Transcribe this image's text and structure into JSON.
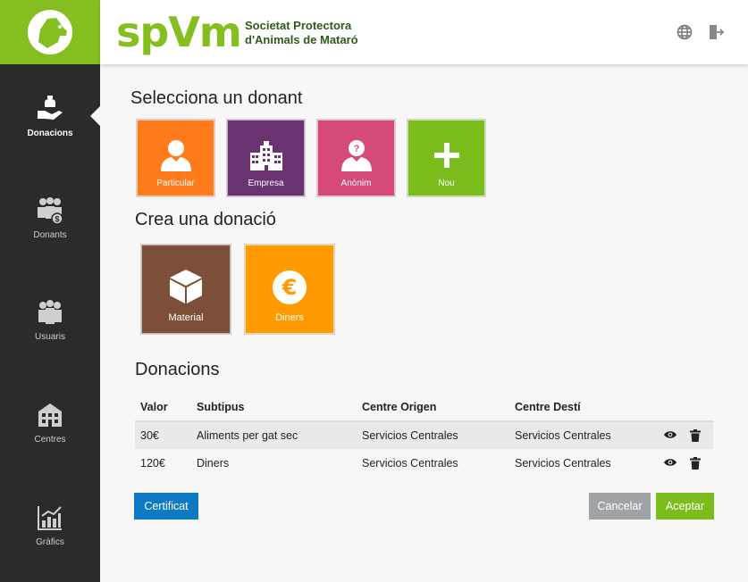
{
  "header": {
    "brand": "spVm",
    "brand_sub_line1": "Societat Protectora",
    "brand_sub_line2": "d'Animals de Mataró",
    "icons": [
      "globe-icon",
      "logout-icon"
    ]
  },
  "sidebar": {
    "items": [
      {
        "label": "Donacions",
        "icon": "donation-hand-icon",
        "active": true
      },
      {
        "label": "Donants",
        "icon": "donors-group-icon",
        "active": false
      },
      {
        "label": "Usuaris",
        "icon": "users-group-icon",
        "active": false
      },
      {
        "label": "Centres",
        "icon": "building-icon",
        "active": false
      },
      {
        "label": "Gràfics",
        "icon": "chart-icon",
        "active": false
      }
    ]
  },
  "main": {
    "donor_title": "Selecciona un donant",
    "donor_tiles": [
      {
        "label": "Particular",
        "color": "#ff7b1c",
        "icon": "person-icon"
      },
      {
        "label": "Empresa",
        "color": "#6a3270",
        "icon": "building-icon"
      },
      {
        "label": "Anònim",
        "color": "#d6497b",
        "icon": "anonymous-person-icon"
      },
      {
        "label": "Nou",
        "color": "#7cbd1e",
        "icon": "plus-icon"
      }
    ],
    "create_title": "Crea una donació",
    "create_tiles": [
      {
        "label": "Material",
        "color": "#7e4f38",
        "icon": "box-icon"
      },
      {
        "label": "Diners",
        "color": "#ff9a00",
        "icon": "euro-icon"
      }
    ],
    "donations_title": "Donacions",
    "table": {
      "columns": [
        "Valor",
        "Subtipus",
        "Centre Origen",
        "Centre Destí"
      ],
      "rows": [
        [
          "30€",
          "Aliments per gat sec",
          "Servicios Centrales",
          "Servicios Centrales"
        ],
        [
          "120€",
          "Diners",
          "Servicios Centrales",
          "Servicios Centrales"
        ]
      ]
    },
    "buttons": {
      "certificate": "Certificat",
      "cancel": "Cancelar",
      "accept": "Aceptar"
    }
  },
  "colors": {
    "accent": "#85bf1f",
    "sidebar_bg": "#2b2b2b",
    "certificate_btn": "#0e7ac4",
    "cancel_btn": "#a0a4a6",
    "accept_btn": "#7cbd1e"
  }
}
